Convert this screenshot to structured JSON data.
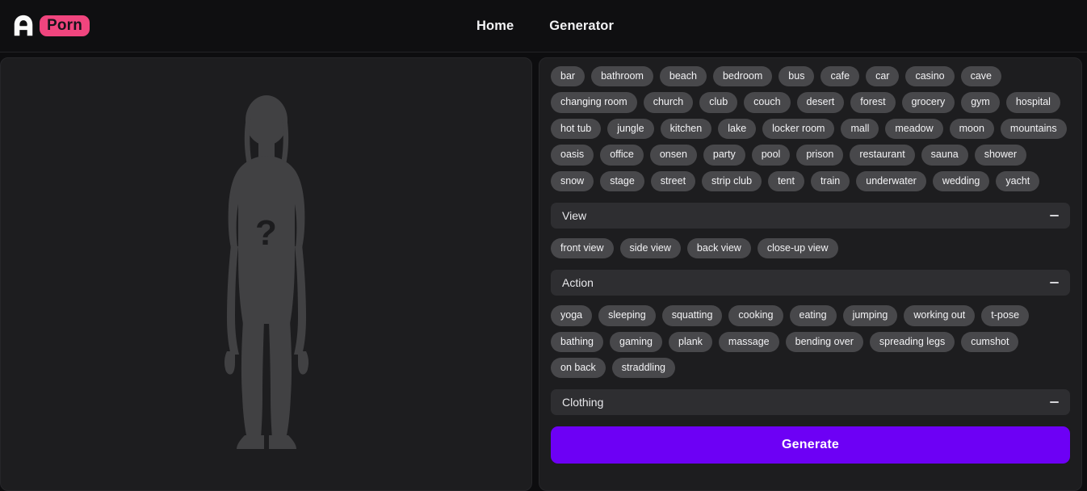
{
  "header": {
    "logo_mark_icon": "arch-a-icon",
    "logo_badge_text": "Porn",
    "nav": [
      {
        "label": "Home"
      },
      {
        "label": "Generator"
      }
    ]
  },
  "preview": {
    "placeholder_icon": "female-silhouette-icon",
    "question_mark": "?"
  },
  "options": {
    "location_tags": [
      "bar",
      "bathroom",
      "beach",
      "bedroom",
      "bus",
      "cafe",
      "car",
      "casino",
      "cave",
      "changing room",
      "church",
      "club",
      "couch",
      "desert",
      "forest",
      "grocery",
      "gym",
      "hospital",
      "hot tub",
      "jungle",
      "kitchen",
      "lake",
      "locker room",
      "mall",
      "meadow",
      "moon",
      "mountains",
      "oasis",
      "office",
      "onsen",
      "party",
      "pool",
      "prison",
      "restaurant",
      "sauna",
      "shower",
      "snow",
      "stage",
      "street",
      "strip club",
      "tent",
      "train",
      "underwater",
      "wedding",
      "yacht"
    ],
    "sections": [
      {
        "title": "View",
        "collapse_icon": "minus-icon",
        "tags": [
          "front view",
          "side view",
          "back view",
          "close-up view"
        ]
      },
      {
        "title": "Action",
        "collapse_icon": "minus-icon",
        "tags": [
          "yoga",
          "sleeping",
          "squatting",
          "cooking",
          "eating",
          "jumping",
          "working out",
          "t-pose",
          "bathing",
          "gaming",
          "plank",
          "massage",
          "bending over",
          "spreading legs",
          "cumshot",
          "on back",
          "straddling"
        ]
      },
      {
        "title": "Clothing",
        "collapse_icon": "minus-icon",
        "tags": []
      }
    ],
    "generate_label": "Generate"
  },
  "colors": {
    "page_background": "#0d0d0f",
    "card_background": "#1d1d1f",
    "pill_background": "#48484b",
    "section_header_background": "#2e2e31",
    "accent_purple": "#6d00f5",
    "brand_pink": "#f0457e"
  }
}
